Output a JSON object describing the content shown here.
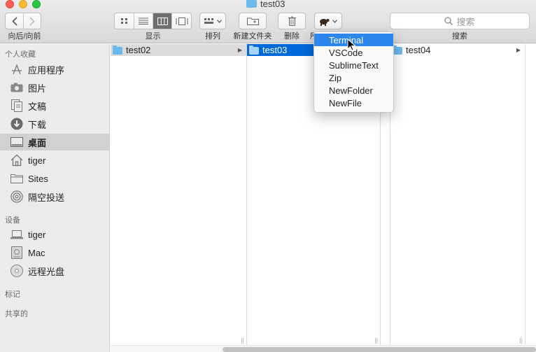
{
  "window": {
    "title": "test03"
  },
  "toolbar": {
    "nav_label": "向后/向前",
    "view_label": "显示",
    "arrange_label": "排列",
    "new_folder_label": "新建文件夹",
    "delete_label": "删除",
    "action_label": "所",
    "search_placeholder": "搜索",
    "search_label": "搜索"
  },
  "sidebar": {
    "favorites_title": "个人收藏",
    "favorites": [
      {
        "label": "应用程序",
        "icon": "applications-icon"
      },
      {
        "label": "图片",
        "icon": "camera-icon"
      },
      {
        "label": "文稿",
        "icon": "documents-icon"
      },
      {
        "label": "下载",
        "icon": "download-icon"
      },
      {
        "label": "桌面",
        "icon": "desktop-icon",
        "selected": true
      },
      {
        "label": "tiger",
        "icon": "home-icon"
      },
      {
        "label": "Sites",
        "icon": "folder-icon"
      },
      {
        "label": "隔空投送",
        "icon": "airdrop-icon"
      }
    ],
    "devices_title": "设备",
    "devices": [
      {
        "label": "tiger",
        "icon": "laptop-icon"
      },
      {
        "label": "Mac",
        "icon": "hard-drive-icon"
      },
      {
        "label": "远程光盘",
        "icon": "disc-icon"
      }
    ],
    "tags_title": "标记",
    "shared_title": "共享的"
  },
  "columns": [
    {
      "items": [
        {
          "label": "test02"
        }
      ]
    },
    {
      "items": [
        {
          "label": "test03"
        }
      ]
    },
    {
      "items": [
        {
          "label": "test04"
        }
      ]
    }
  ],
  "menu": {
    "items": [
      "Terminal",
      "VSCode",
      "SublimeText",
      "Zip",
      "NewFolder",
      "NewFile"
    ],
    "highlighted": "Terminal"
  },
  "colors": {
    "selection": "#0069d9",
    "menu_highlight": "#2d86ea",
    "folder": "#6cb9ee"
  }
}
